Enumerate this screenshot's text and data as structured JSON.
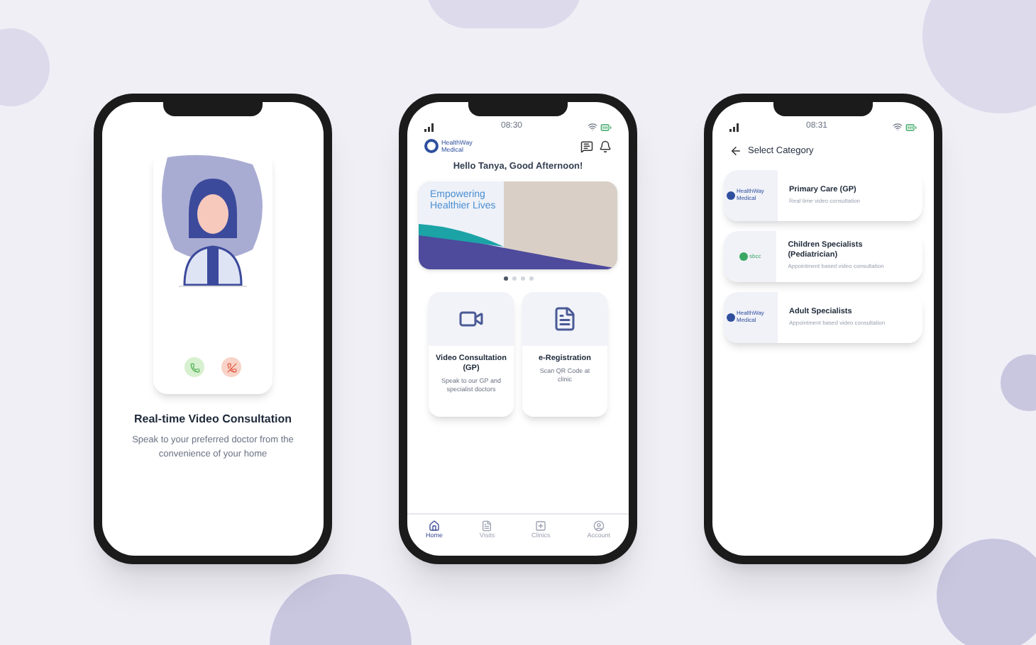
{
  "phones": [
    {
      "kind": "intro",
      "title": "Real-time Video Consultation",
      "description": "Speak to your preferred doctor from the convenience of your home"
    },
    {
      "kind": "home",
      "status_time": "08:30",
      "logo_text": "HealthWay Medical",
      "greeting": "Hello Tanya, Good Afternoon!",
      "banner_text": "Empowering Healthier Lives",
      "carousel_dots": [
        {
          "selected": true
        },
        {
          "selected": false
        },
        {
          "selected": false
        },
        {
          "selected": false
        }
      ],
      "cards": [
        {
          "kind": "video",
          "title": "Video Consultation (GP)",
          "description": "Speak to our GP and specialist doctors"
        },
        {
          "kind": "form",
          "title": "e-Registration",
          "description": "Scan QR Code at clinic"
        }
      ],
      "nav": [
        {
          "kind": "home",
          "label": "Home",
          "selected": true
        },
        {
          "kind": "doc",
          "label": "Visits",
          "selected": false
        },
        {
          "kind": "plus",
          "label": "Clinics",
          "selected": false
        },
        {
          "kind": "user",
          "label": "Account",
          "selected": false
        }
      ]
    },
    {
      "kind": "category",
      "status_time": "08:31",
      "title": "Select Category",
      "categories": [
        {
          "logo_text": "HealthWay Medical",
          "color": "#2f4f9e",
          "name": "Primary Care (GP)",
          "description": "Real time video consultation"
        },
        {
          "logo_text": "sbcc",
          "color": "#3aa864",
          "name": "Children Specialists (Pediatrician)",
          "description": "Appointment based video consultation"
        },
        {
          "logo_text": "HealthWay Medical",
          "color": "#2f4f9e",
          "name": "Adult Specialists",
          "description": "Appointment based video consultation"
        }
      ]
    }
  ]
}
